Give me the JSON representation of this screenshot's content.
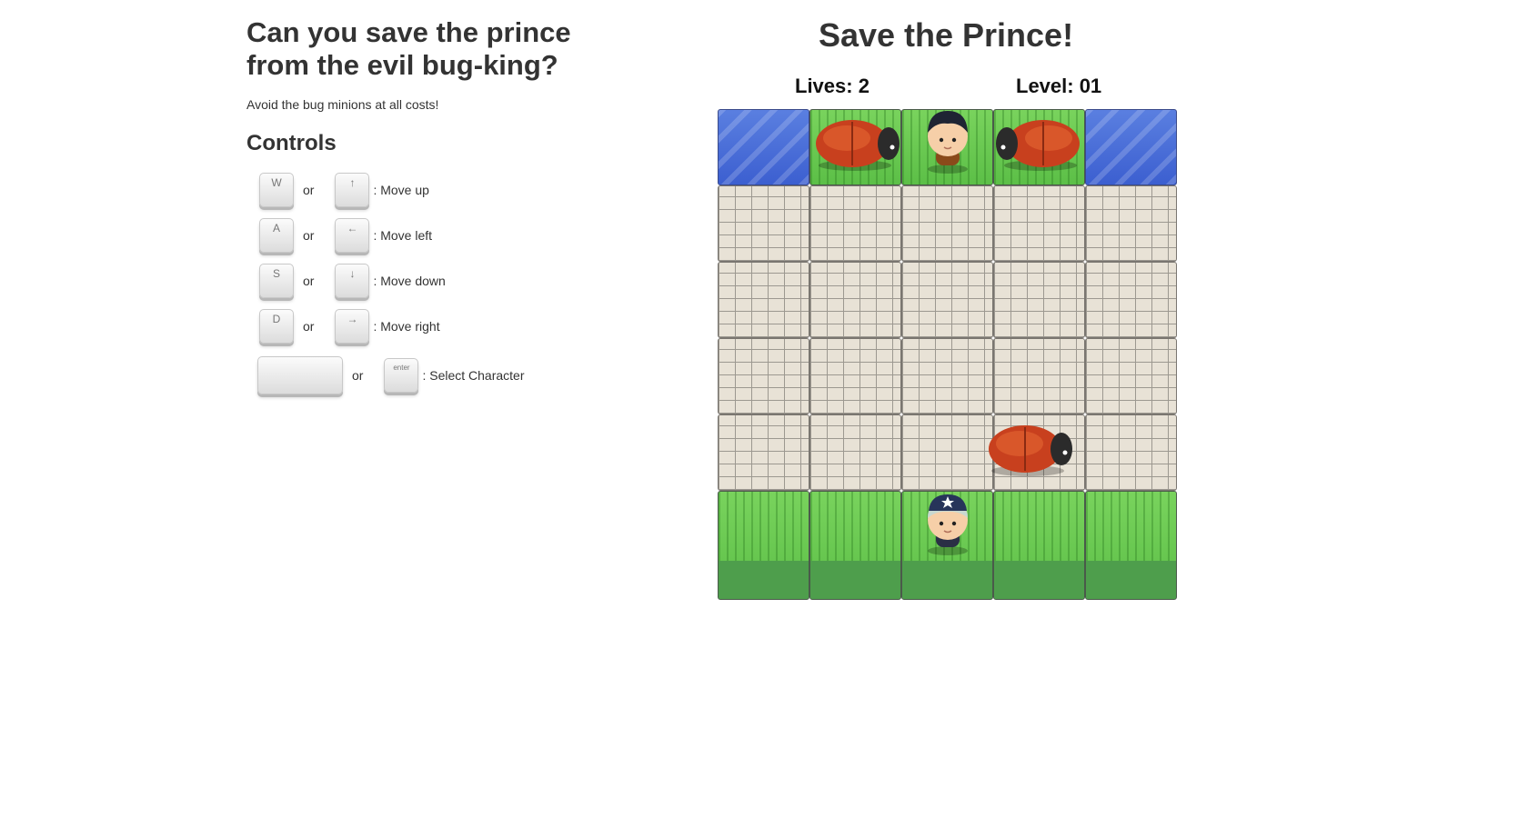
{
  "left": {
    "headline_line1": "Can you save the prince",
    "headline_line2": "from the evil bug-king?",
    "subtitle": "Avoid the bug minions at all costs!",
    "controls_title": "Controls",
    "controls": [
      {
        "key1": "W",
        "key2": "↑",
        "or": "or",
        "desc": ": Move up"
      },
      {
        "key1": "A",
        "key2": "←",
        "or": "or",
        "desc": ": Move left"
      },
      {
        "key1": "S",
        "key2": "↓",
        "or": "or",
        "desc": ": Move down"
      },
      {
        "key1": "D",
        "key2": "→",
        "or": "or",
        "desc": ": Move right"
      },
      {
        "key1": "",
        "key2": "enter",
        "or": "or",
        "desc": ": Select Character"
      }
    ]
  },
  "game": {
    "title": "Save the Prince!",
    "lives_label": "Lives: 2",
    "level_label": "Level: 01",
    "lives": 2,
    "level": "01",
    "grid_rows": [
      "water",
      "grass",
      "grass",
      "grass",
      "water"
    ],
    "colors": {
      "water": "#4a6fd8",
      "grass": "#6cc852",
      "stone": "#e8e2d6",
      "bug": "#d0401e"
    }
  }
}
